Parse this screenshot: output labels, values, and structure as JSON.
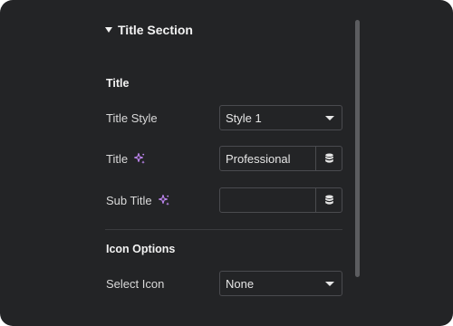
{
  "section": {
    "title": "Title Section",
    "expanded": true
  },
  "groups": {
    "title_heading": "Title",
    "icon_heading": "Icon Options"
  },
  "fields": {
    "title_style": {
      "label": "Title Style",
      "value": "Style 1"
    },
    "title": {
      "label": "Title",
      "value": "Professional",
      "placeholder": ""
    },
    "sub_title": {
      "label": "Sub Title",
      "value": "",
      "placeholder": ""
    },
    "select_icon": {
      "label": "Select Icon",
      "value": "None"
    }
  },
  "icons": {
    "section_toggle": "caret-down-icon",
    "ai": "sparkle-icon",
    "dynamic": "database-icon",
    "dropdown": "chevron-down-icon"
  },
  "colors": {
    "panel_bg": "#232426",
    "ai_accent": "#c58af9",
    "border": "#4a4b4f"
  }
}
